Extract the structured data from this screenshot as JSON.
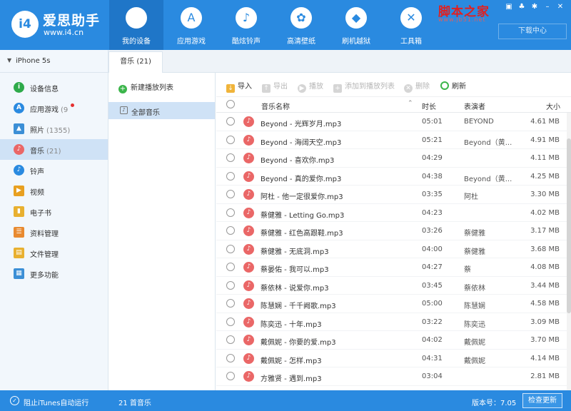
{
  "app": {
    "logo_mark": "i4",
    "name": "爱思助手",
    "url": "www.i4.cn"
  },
  "nav": [
    {
      "label": "我的设备",
      "icon": "apple-icon",
      "glyph": "",
      "active": true
    },
    {
      "label": "应用游戏",
      "icon": "app-store-icon",
      "glyph": "A"
    },
    {
      "label": "酷炫铃声",
      "icon": "bell-icon",
      "glyph": "♪"
    },
    {
      "label": "高清壁纸",
      "icon": "gear-flower-icon",
      "glyph": "✿"
    },
    {
      "label": "刷机越狱",
      "icon": "dropbox-icon",
      "glyph": "◆"
    },
    {
      "label": "工具箱",
      "icon": "tools-icon",
      "glyph": "✕"
    }
  ],
  "watermark": {
    "title": "脚本之家",
    "url": "www.jb51.net"
  },
  "window_controls": [
    "feedback-icon",
    "skin-icon",
    "settings-icon",
    "minimize-icon",
    "close-icon"
  ],
  "download_center": "下载中心",
  "device": {
    "name": "iPhone 5s"
  },
  "sidebar": {
    "items": [
      {
        "label": "设备信息",
        "count": "",
        "icon": "info-icon",
        "color": "#2eaa4a",
        "glyph": "i"
      },
      {
        "label": "应用游戏",
        "count": "(9",
        "icon": "app-store-icon",
        "color": "#2a8ae0",
        "glyph": "A",
        "dot": true
      },
      {
        "label": "照片",
        "count": "(1355)",
        "icon": "photo-icon",
        "color": "#3c8fd6",
        "glyph": "▲"
      },
      {
        "label": "音乐",
        "count": "(21)",
        "icon": "music-icon",
        "color": "#ea6767",
        "glyph": "♪",
        "active": true
      },
      {
        "label": "铃声",
        "count": "",
        "icon": "bell-icon",
        "color": "#2a8ae0",
        "glyph": "♪"
      },
      {
        "label": "视频",
        "count": "",
        "icon": "video-icon",
        "color": "#e8a020",
        "glyph": "▶"
      },
      {
        "label": "电子书",
        "count": "",
        "icon": "book-icon",
        "color": "#e8b030",
        "glyph": "▮"
      },
      {
        "label": "资料管理",
        "count": "",
        "icon": "contacts-icon",
        "color": "#e88a30",
        "glyph": "☰"
      },
      {
        "label": "文件管理",
        "count": "",
        "icon": "file-icon",
        "color": "#e8b030",
        "glyph": "▤"
      },
      {
        "label": "更多功能",
        "count": "",
        "icon": "more-icon",
        "color": "#3c8fd6",
        "glyph": "▦"
      }
    ]
  },
  "tab": {
    "label": "音乐 (21)"
  },
  "playlists": {
    "new_label": "新建播放列表",
    "all_label": "全部音乐"
  },
  "toolbar": {
    "import": "导入",
    "export": "导出",
    "play": "播放",
    "add_to_playlist": "添加到播放列表",
    "delete": "删除",
    "refresh": "刷新"
  },
  "table": {
    "headers": {
      "name": "音乐名称",
      "duration": "时长",
      "artist": "表演者",
      "size": "大小"
    },
    "rows": [
      {
        "name": "Beyond - 光辉岁月.mp3",
        "duration": "05:01",
        "artist": "BEYOND",
        "size": "4.61 MB"
      },
      {
        "name": "Beyond - 海阔天空.mp3",
        "duration": "05:21",
        "artist": "Beyond（黄...",
        "size": "4.91 MB"
      },
      {
        "name": "Beyond - 喜欢你.mp3",
        "duration": "04:29",
        "artist": "",
        "size": "4.11 MB"
      },
      {
        "name": "Beyond - 真的爱你.mp3",
        "duration": "04:38",
        "artist": "Beyond（黄...",
        "size": "4.25 MB"
      },
      {
        "name": "阿杜 - 他一定很爱你.mp3",
        "duration": "03:35",
        "artist": "阿杜",
        "size": "3.30 MB"
      },
      {
        "name": "蔡健雅 - Letting Go.mp3",
        "duration": "04:23",
        "artist": "",
        "size": "4.02 MB"
      },
      {
        "name": "蔡健雅 - 红色高跟鞋.mp3",
        "duration": "03:26",
        "artist": "蔡健雅",
        "size": "3.17 MB"
      },
      {
        "name": "蔡健雅 - 无底洞.mp3",
        "duration": "04:00",
        "artist": "蔡健雅",
        "size": "3.68 MB"
      },
      {
        "name": "蔡晏佑 - 我可以.mp3",
        "duration": "04:27",
        "artist": "蔡",
        "size": "4.08 MB"
      },
      {
        "name": "蔡依林 - 说爱你.mp3",
        "duration": "03:45",
        "artist": "蔡依林",
        "size": "3.44 MB"
      },
      {
        "name": "陈慧娴 - 千千阙歌.mp3",
        "duration": "05:00",
        "artist": "陈慧娴",
        "size": "4.58 MB"
      },
      {
        "name": "陈奕迅 - 十年.mp3",
        "duration": "03:22",
        "artist": "陈奕迅",
        "size": "3.09 MB"
      },
      {
        "name": "戴佩妮 - 你要的爱.mp3",
        "duration": "04:02",
        "artist": "戴佩妮",
        "size": "3.70 MB"
      },
      {
        "name": "戴佩妮 - 怎样.mp3",
        "duration": "04:31",
        "artist": "戴佩妮",
        "size": "4.14 MB"
      },
      {
        "name": "方雅贤 - 遇到.mp3",
        "duration": "03:04",
        "artist": "",
        "size": "2.81 MB"
      }
    ]
  },
  "status": {
    "itunes": "阻止iTunes自动运行",
    "count": "21 首音乐",
    "version": "版本号：7.05",
    "check_update": "检查更新"
  },
  "colors": {
    "brand": "#2a8ae0",
    "active_nav": "#1f76c8",
    "music_icon": "#ea6767",
    "selected_bg": "#cfe2f6"
  }
}
